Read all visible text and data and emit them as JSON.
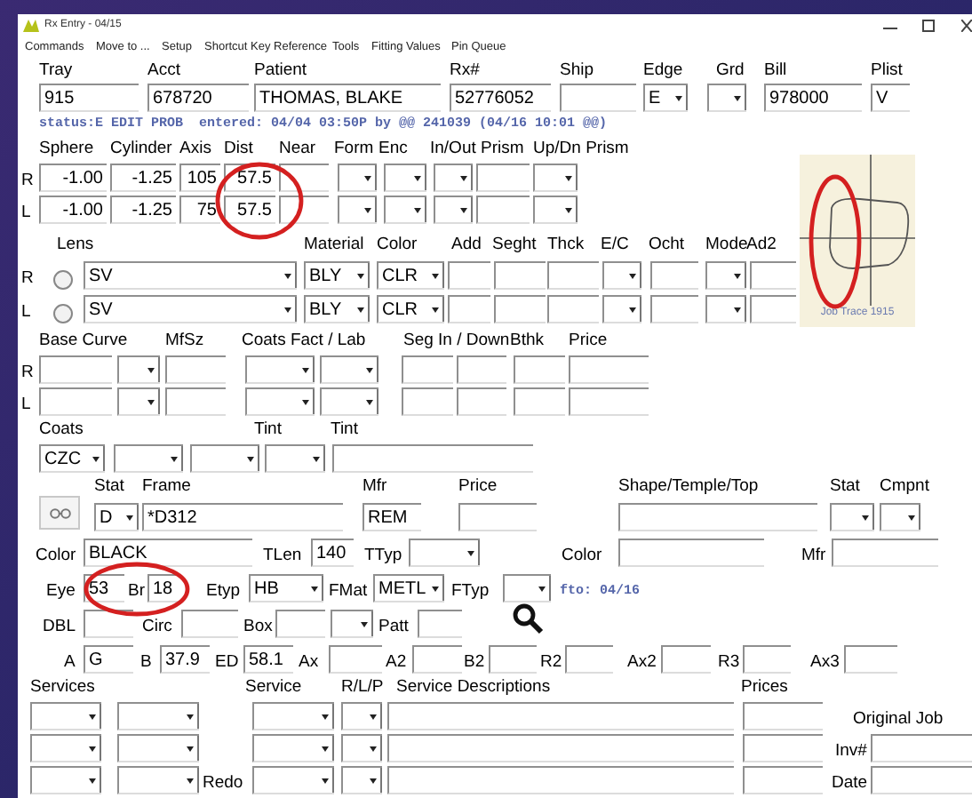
{
  "window": {
    "title": "Rx Entry - 04/15"
  },
  "menu": [
    "Commands",
    "Move to ...",
    "Setup",
    "Shortcut Key Reference",
    "Tools",
    "Fitting Values",
    "Pin Queue"
  ],
  "header": {
    "labels": [
      "Tray",
      "Acct",
      "Patient",
      "Rx#",
      "Ship",
      "Edge",
      "Grd",
      "Bill",
      "Plist"
    ],
    "rows": [
      {
        "cells": [
          {
            "kind": "text",
            "value": "915"
          },
          {
            "kind": "text",
            "value": "678720"
          },
          {
            "kind": "text",
            "value": "THOMAS, BLAKE"
          },
          {
            "kind": "text",
            "value": "52776052"
          },
          {
            "kind": "text"
          },
          {
            "kind": "select",
            "value": "E"
          },
          {
            "kind": "select"
          },
          {
            "kind": "text",
            "value": "978000"
          },
          {
            "kind": "text",
            "value": "V"
          }
        ]
      }
    ]
  },
  "status_line": "status:E EDIT PROB  entered: 04/04 03:50P by @@ 241039 (04/16 10:01 @@)",
  "prescription": {
    "labels": [
      "Sphere",
      "Cylinder",
      "Axis",
      "Dist",
      "Near",
      "Form",
      "Enc",
      "In/Out Prism",
      "Up/Dn Prism"
    ],
    "rows": [
      {
        "side": "R",
        "cells": [
          {
            "kind": "text",
            "value": "-1.00"
          },
          {
            "kind": "text",
            "value": "-1.25"
          },
          {
            "kind": "text",
            "value": "105"
          },
          {
            "kind": "text",
            "value": "57.5"
          },
          {
            "kind": "text"
          },
          {
            "kind": "select"
          },
          {
            "kind": "select"
          },
          {
            "kind": "select"
          },
          {
            "kind": "text"
          },
          {
            "kind": "select"
          }
        ]
      },
      {
        "side": "L",
        "cells": [
          {
            "kind": "text",
            "value": "-1.00"
          },
          {
            "kind": "text",
            "value": "-1.25"
          },
          {
            "kind": "text",
            "value": "75"
          },
          {
            "kind": "text",
            "value": "57.5"
          },
          {
            "kind": "text"
          },
          {
            "kind": "select"
          },
          {
            "kind": "select"
          },
          {
            "kind": "select"
          },
          {
            "kind": "text"
          },
          {
            "kind": "select"
          }
        ]
      }
    ]
  },
  "lens": {
    "labels": [
      "Lens",
      "Material",
      "Color",
      "Add",
      "Seght",
      "Thck",
      "E/C",
      "Ocht",
      "Mode",
      "Ad2"
    ],
    "rows": [
      {
        "side": "R",
        "cells": [
          {
            "kind": "radio",
            "selected": false
          },
          {
            "kind": "select",
            "value": "SV"
          },
          {
            "kind": "select",
            "value": "BLY"
          },
          {
            "kind": "select",
            "value": "CLR"
          },
          {
            "kind": "text"
          },
          {
            "kind": "text"
          },
          {
            "kind": "text"
          },
          {
            "kind": "select"
          },
          {
            "kind": "text"
          },
          {
            "kind": "select"
          },
          {
            "kind": "text"
          }
        ]
      },
      {
        "side": "L",
        "cells": [
          {
            "kind": "radio",
            "selected": false
          },
          {
            "kind": "select",
            "value": "SV"
          },
          {
            "kind": "select",
            "value": "BLY"
          },
          {
            "kind": "select",
            "value": "CLR"
          },
          {
            "kind": "text"
          },
          {
            "kind": "text"
          },
          {
            "kind": "text"
          },
          {
            "kind": "select"
          },
          {
            "kind": "text"
          },
          {
            "kind": "select"
          },
          {
            "kind": "text"
          }
        ]
      }
    ]
  },
  "trace": {
    "caption": "Job Trace 1915"
  },
  "base": {
    "labels": [
      "Base Curve",
      "MfSz",
      "Coats Fact / Lab",
      "Seg In / Down",
      "Bthk",
      "Price"
    ],
    "rows": [
      {
        "side": "R",
        "cells": [
          {
            "kind": "text"
          },
          {
            "kind": "select"
          },
          {
            "kind": "text"
          },
          {
            "kind": "select"
          },
          {
            "kind": "select"
          },
          {
            "kind": "text"
          },
          {
            "kind": "text"
          },
          {
            "kind": "text"
          },
          {
            "kind": "text"
          }
        ]
      },
      {
        "side": "L",
        "cells": [
          {
            "kind": "text"
          },
          {
            "kind": "select"
          },
          {
            "kind": "text"
          },
          {
            "kind": "select"
          },
          {
            "kind": "select"
          },
          {
            "kind": "text"
          },
          {
            "kind": "text"
          },
          {
            "kind": "text"
          },
          {
            "kind": "text"
          }
        ]
      }
    ]
  },
  "coats": {
    "labels": [
      "Coats",
      "Tint",
      "Tint"
    ],
    "rows": [
      {
        "cells": [
          {
            "kind": "select",
            "value": "CZC"
          },
          {
            "kind": "select"
          },
          {
            "kind": "select"
          },
          {
            "kind": "select"
          },
          {
            "kind": "text"
          }
        ]
      }
    ]
  },
  "frame": {
    "labels": [
      "Stat",
      "Frame",
      "Mfr",
      "Price",
      "Shape/Temple/Top",
      "Stat",
      "Cmpnt"
    ],
    "rows": [
      {
        "cells": [
          {
            "kind": "glasses_button"
          },
          {
            "kind": "select",
            "value": "D"
          },
          {
            "kind": "text",
            "value": "*D312"
          },
          {
            "kind": "text",
            "value": "REM"
          },
          {
            "kind": "text"
          },
          {
            "kind": "text"
          },
          {
            "kind": "select"
          },
          {
            "kind": "select"
          }
        ]
      }
    ]
  },
  "measurements": {
    "rows": [
      {
        "items": [
          {
            "label": "Color",
            "kind": "text",
            "value": "BLACK"
          },
          {
            "label": "TLen",
            "kind": "text",
            "value": "140"
          },
          {
            "label": "TTyp",
            "kind": "select"
          },
          {
            "label": "Color",
            "kind": "text"
          },
          {
            "label": "Mfr",
            "kind": "text"
          }
        ]
      },
      {
        "items": [
          {
            "label": "Eye",
            "kind": "text",
            "value": "53"
          },
          {
            "label": "Br",
            "kind": "text",
            "value": "18"
          },
          {
            "label": "Etyp",
            "kind": "select",
            "value": "HB"
          },
          {
            "label": "FMat",
            "kind": "select",
            "value": "METL"
          },
          {
            "label": "FTyp",
            "kind": "select"
          },
          {
            "kind": "note",
            "text": "fto: 04/16"
          }
        ]
      },
      {
        "items": [
          {
            "label": "DBL",
            "kind": "text"
          },
          {
            "label": "Circ",
            "kind": "text"
          },
          {
            "label": "Box",
            "kind": "text"
          },
          {
            "kind": "select"
          },
          {
            "label": "Patt",
            "kind": "text"
          },
          {
            "kind": "search"
          }
        ]
      },
      {
        "items": [
          {
            "label": "A",
            "kind": "text",
            "value": "G"
          },
          {
            "label": "B",
            "kind": "text",
            "value": "37.9"
          },
          {
            "label": "ED",
            "kind": "text",
            "value": "58.1"
          },
          {
            "label": "Ax",
            "kind": "text"
          },
          {
            "label": "A2",
            "kind": "text"
          },
          {
            "label": "B2",
            "kind": "text"
          },
          {
            "label": "R2",
            "kind": "text"
          },
          {
            "label": "Ax2",
            "kind": "text"
          },
          {
            "label": "R3",
            "kind": "text"
          },
          {
            "label": "Ax3",
            "kind": "text"
          }
        ]
      }
    ]
  },
  "services": {
    "labels": [
      "Services",
      "Service",
      "R/L/P",
      "Service Descriptions",
      "Prices"
    ],
    "rows": [
      {
        "cells": [
          {
            "kind": "select"
          },
          {
            "kind": "select"
          },
          {
            "kind": "select"
          },
          {
            "kind": "select"
          },
          {
            "kind": "text"
          },
          {
            "kind": "text"
          },
          {
            "kind": "label",
            "text": "Original Job"
          }
        ]
      },
      {
        "cells": [
          {
            "kind": "select"
          },
          {
            "kind": "select"
          },
          {
            "kind": "select"
          },
          {
            "kind": "select"
          },
          {
            "kind": "text"
          },
          {
            "kind": "text"
          },
          {
            "kind": "label",
            "text": "Inv#"
          },
          {
            "kind": "text"
          }
        ]
      },
      {
        "cells": [
          {
            "kind": "select"
          },
          {
            "kind": "select"
          },
          {
            "kind": "label",
            "text": "Redo"
          },
          {
            "kind": "select"
          },
          {
            "kind": "select"
          },
          {
            "kind": "text"
          },
          {
            "kind": "text"
          },
          {
            "kind": "label",
            "text": "Date"
          },
          {
            "kind": "text"
          }
        ]
      }
    ]
  }
}
